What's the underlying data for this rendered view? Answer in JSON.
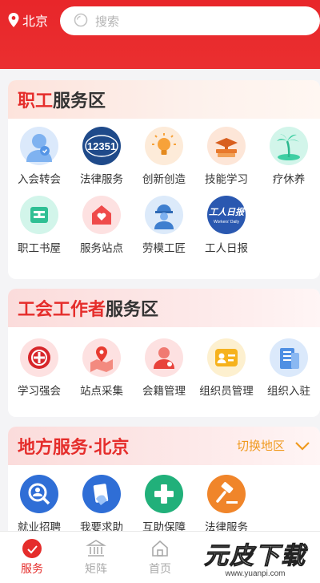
{
  "header": {
    "city": "北京",
    "search_placeholder": "搜索"
  },
  "worker_section": {
    "title_accent": "职工",
    "title_rest": "服务区",
    "items": [
      {
        "label": "入会转会",
        "icon": "person-badge-icon"
      },
      {
        "label": "法律服务",
        "icon": "hotline-12351-icon"
      },
      {
        "label": "创新创造",
        "icon": "lightbulb-icon"
      },
      {
        "label": "技能学习",
        "icon": "books-icon"
      },
      {
        "label": "疗休养",
        "icon": "palm-island-icon"
      },
      {
        "label": "职工书屋",
        "icon": "library-icon"
      },
      {
        "label": "服务站点",
        "icon": "heart-house-icon"
      },
      {
        "label": "劳模工匠",
        "icon": "worker-helmet-icon"
      },
      {
        "label": "工人日报",
        "icon": "newspaper-logo-icon"
      }
    ],
    "newspaper_logo_text": "工人日报",
    "newspaper_logo_subtext": "Workers' Daily",
    "hotline_number": "12351"
  },
  "union_section": {
    "title_accent": "工会工作者",
    "title_rest": "服务区",
    "items": [
      {
        "label": "学习强会",
        "icon": "union-emblem-icon"
      },
      {
        "label": "站点采集",
        "icon": "map-pin-icon"
      },
      {
        "label": "会籍管理",
        "icon": "member-icon"
      },
      {
        "label": "组织员管理",
        "icon": "id-card-icon"
      },
      {
        "label": "组织入驻",
        "icon": "building-icon"
      }
    ]
  },
  "local_section": {
    "title_accent": "地方服务·北京",
    "switch_label": "切换地区",
    "items": [
      {
        "label": "就业招聘",
        "icon": "search-person-icon"
      },
      {
        "label": "我要求助",
        "icon": "help-hand-icon"
      },
      {
        "label": "互助保障",
        "icon": "medical-cross-icon"
      },
      {
        "label": "法律服务",
        "icon": "gavel-icon"
      }
    ]
  },
  "tabbar": {
    "tabs": [
      {
        "label": "服务",
        "active": true
      },
      {
        "label": "矩阵",
        "active": false
      },
      {
        "label": "首页",
        "active": false
      }
    ]
  },
  "watermark": {
    "text": "元皮下载",
    "url": "www.yuanpi.com"
  },
  "colors": {
    "brand_red": "#e52d2b",
    "switch_orange": "#f09a1f"
  }
}
